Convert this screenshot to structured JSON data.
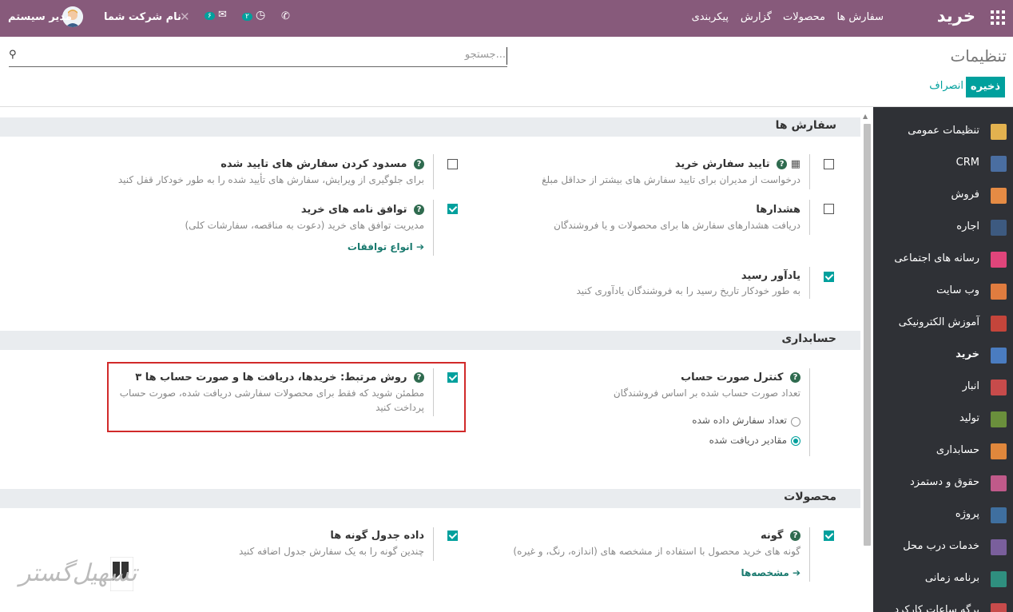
{
  "topbar": {
    "brand": "خرید",
    "menu": [
      "سفارش ها",
      "محصولات",
      "گزارش",
      "پیکربندی"
    ],
    "company": "نام شرکت شما",
    "user": "مدیر سیستم",
    "messages_count": "۶",
    "activities_count": "۲"
  },
  "control": {
    "breadcrumb": "تنظیمات",
    "search_placeholder": "جستجو...",
    "save": "ذخیره",
    "cancel": "انصراف"
  },
  "sidebar": {
    "items": [
      {
        "label": "تنظیمات عمومی",
        "color": "#e3b24f"
      },
      {
        "label": "CRM",
        "color": "#4a6ea1"
      },
      {
        "label": "فروش",
        "color": "#e58b44"
      },
      {
        "label": "اجاره",
        "color": "#3d5a80"
      },
      {
        "label": "رسانه های اجتماعی",
        "color": "#e0457b"
      },
      {
        "label": "وب سایت",
        "color": "#e07c3f"
      },
      {
        "label": "آموزش الکترونیکی",
        "color": "#c4453b"
      },
      {
        "label": "خرید",
        "color": "#4a7cc0"
      },
      {
        "label": "انبار",
        "color": "#c74b4b"
      },
      {
        "label": "تولید",
        "color": "#6a8f3c"
      },
      {
        "label": "حسابداری",
        "color": "#e0873c"
      },
      {
        "label": "حقوق و دستمزد",
        "color": "#c05a8a"
      },
      {
        "label": "پروژه",
        "color": "#3f6f9f"
      },
      {
        "label": "خدمات درب محل",
        "color": "#7a5f9c"
      },
      {
        "label": "برنامه زمانی",
        "color": "#2f8f7f"
      },
      {
        "label": "برگه ساعات کارکرد",
        "color": "#c74b4b"
      }
    ]
  },
  "sections": {
    "orders": {
      "title": "سفارش ها",
      "po_approval": {
        "title": "تایید سفارش خرید",
        "desc": "درخواست از مدیران برای تایید سفارش های بیشتر از حداقل مبلغ"
      },
      "lock_orders": {
        "title": "مسدود کردن سفارش های تایید شده",
        "desc": "برای جلوگیری از ویرایش، سفارش های تأیید شده را به طور خودکار قفل کنید"
      },
      "warnings": {
        "title": "هشدارها",
        "desc": "دریافت هشدارهای سفارش ها برای محصولات و یا فروشندگان"
      },
      "agreements": {
        "title": "توافق نامه های خرید",
        "desc": "مدیریت توافق های خرید (دعوت به مناقصه، سفارشات کلی)",
        "link": "انواع توافقات"
      },
      "receipt_reminder": {
        "title": "یادآور رسید",
        "desc": "به طور خودکار تاریخ رسید را به فروشندگان یادآوری کنید"
      }
    },
    "accounting": {
      "title": "حسابداری",
      "bill_control": {
        "title": "کنترل صورت حساب",
        "desc": "تعداد صورت حساب شده بر اساس فروشندگان",
        "opt1": "تعداد سفارش داده شده",
        "opt2": "مقادیر دریافت شده"
      },
      "three_way": {
        "title": "۳ روش مرتبط: خریدها، دریافت ها و صورت حساب ها",
        "desc1": "مطمئن شوید که فقط برای محصولات سفارشی دریافت شده، صورت حساب",
        "desc2": "پرداخت کنید"
      }
    },
    "products": {
      "title": "محصولات",
      "variants": {
        "title": "گونه",
        "desc": "گونه های خرید محصول با استفاده از مشخصه های (اندازه، رنگ، و غیره)",
        "link": "مشخصه‌ها"
      },
      "variant_grid": {
        "title": "داده جدول گونه ها",
        "desc": "چندین گونه را به یک سفارش جدول اضافه کنید"
      }
    }
  },
  "watermark": "تسهیل‌گستر"
}
